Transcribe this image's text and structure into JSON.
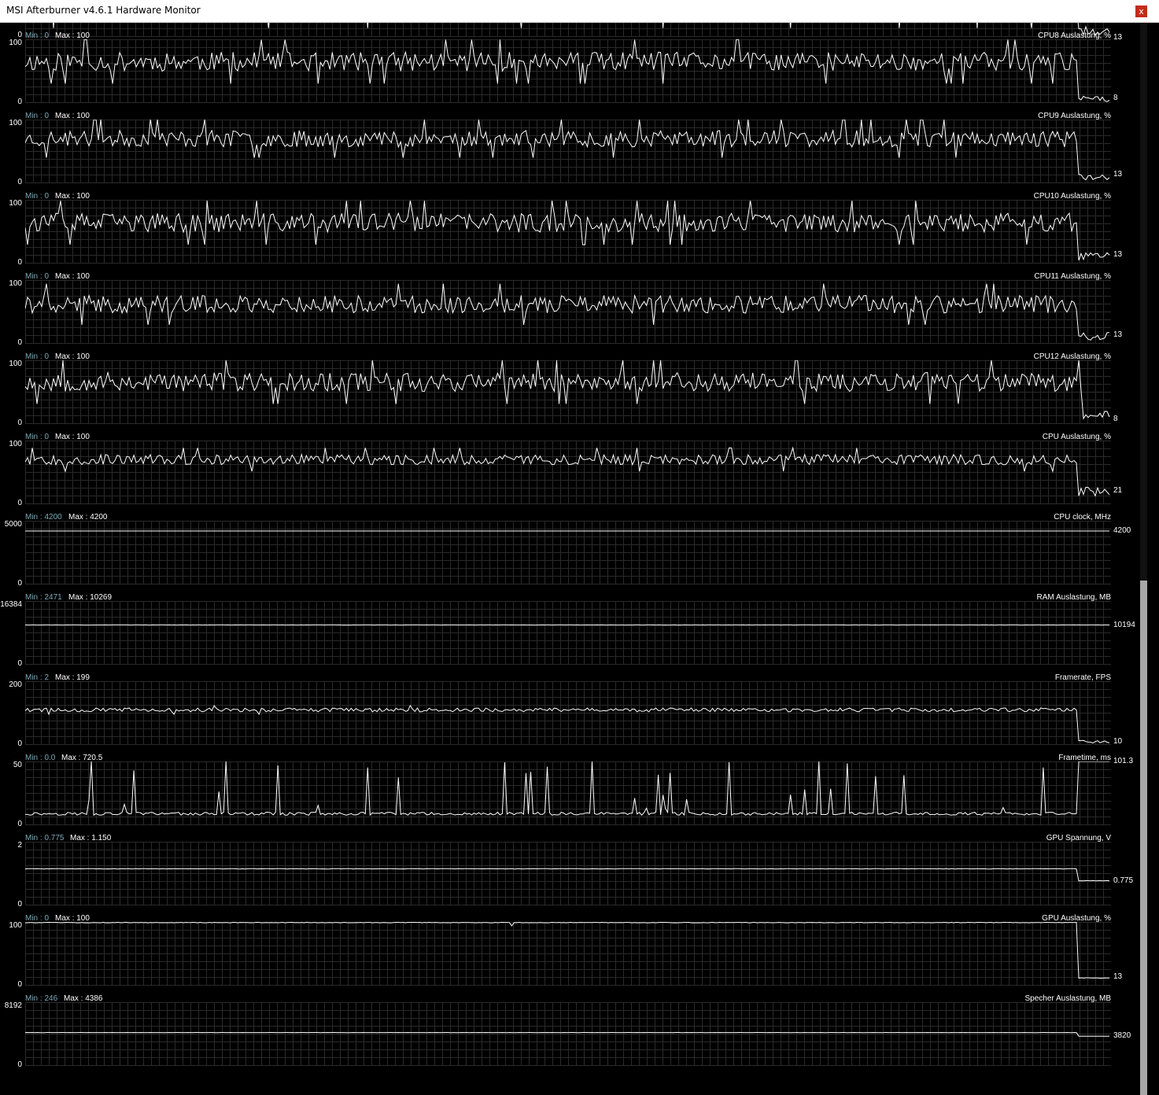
{
  "window": {
    "title": "MSI Afterburner v4.6.1 Hardware Monitor",
    "close_label": "x"
  },
  "scrollbar": {
    "thumb_start": 0.52,
    "thumb_end": 1.0
  },
  "colors": {
    "background": "#000000",
    "grid": "#2a2a2a",
    "trace": "#ffffff",
    "min_label": "#7aa9b9",
    "close_button": "#c42b1c"
  },
  "top_partial": {
    "current": "13"
  },
  "graphs": [
    {
      "name": "CPU8 Auslastung, %",
      "min_label": "Min : 0",
      "max_label": "Max : 100",
      "axis_top": "100",
      "axis_bottom": "0",
      "current": "8",
      "chart_data": {
        "type": "line",
        "ylim": [
          0,
          100
        ],
        "level": 65,
        "noise": 15,
        "spikes": 0.06,
        "end_drop_at": 0.97,
        "end_level": 6,
        "current_value": 8,
        "seed": 11
      }
    },
    {
      "name": "CPU9 Auslastung, %",
      "min_label": "Min : 0",
      "max_label": "Max : 100",
      "axis_top": "100",
      "axis_bottom": "0",
      "current": "13",
      "chart_data": {
        "type": "line",
        "ylim": [
          0,
          100
        ],
        "level": 70,
        "noise": 13,
        "spikes": 0.06,
        "end_drop_at": 0.97,
        "end_level": 10,
        "current_value": 13,
        "seed": 23
      }
    },
    {
      "name": "CPU10 Auslastung, %",
      "min_label": "Min : 0",
      "max_label": "Max : 100",
      "axis_top": "100",
      "axis_bottom": "0",
      "current": "13",
      "chart_data": {
        "type": "line",
        "ylim": [
          0,
          100
        ],
        "level": 64,
        "noise": 15,
        "spikes": 0.06,
        "end_drop_at": 0.97,
        "end_level": 11,
        "current_value": 13,
        "seed": 37
      }
    },
    {
      "name": "CPU11 Auslastung, %",
      "min_label": "Min : 0",
      "max_label": "Max : 100",
      "axis_top": "100",
      "axis_bottom": "0",
      "current": "13",
      "chart_data": {
        "type": "line",
        "ylim": [
          0,
          100
        ],
        "level": 62,
        "noise": 14,
        "spikes": 0.06,
        "end_drop_at": 0.97,
        "end_level": 12,
        "current_value": 13,
        "seed": 41
      }
    },
    {
      "name": "CPU12 Auslastung, %",
      "min_label": "Min : 0",
      "max_label": "Max : 100",
      "axis_top": "100",
      "axis_bottom": "0",
      "current": "8",
      "chart_data": {
        "type": "line",
        "ylim": [
          0,
          100
        ],
        "level": 66,
        "noise": 15,
        "spikes": 0.06,
        "end_drop_at": 0.975,
        "end_level": 14,
        "current_value": 8,
        "seed": 53
      }
    },
    {
      "name": "CPU Auslastung, %",
      "min_label": "Min : 0",
      "max_label": "Max : 100",
      "axis_top": "100",
      "axis_bottom": "0",
      "current": "21",
      "chart_data": {
        "type": "line",
        "ylim": [
          0,
          100
        ],
        "level": 70,
        "noise": 8,
        "spikes": 0.04,
        "end_drop_at": 0.97,
        "end_level": 20,
        "current_value": 21,
        "seed": 67
      }
    },
    {
      "name": "CPU clock, MHz",
      "min_label": "Min : 4200",
      "max_label": "Max : 4200",
      "axis_top": "5000",
      "axis_bottom": "0",
      "current": "4200",
      "chart_data": {
        "type": "line",
        "ylim": [
          0,
          5000
        ],
        "level": 4200,
        "noise": 0,
        "spikes": 0,
        "current_value": 4200,
        "seed": 1
      }
    },
    {
      "name": "RAM Auslastung, MB",
      "min_label": "Min : 2471",
      "max_label": "Max : 10269",
      "axis_top": "16384",
      "axis_bottom": "0",
      "current": "10194",
      "chart_data": {
        "type": "line",
        "ylim": [
          0,
          16384
        ],
        "level": 10220,
        "noise": 25,
        "spikes": 0,
        "current_value": 10194,
        "seed": 2
      }
    },
    {
      "name": "Framerate, FPS",
      "min_label": "Min : 2",
      "max_label": "Max : 199",
      "axis_top": "200",
      "axis_bottom": "0",
      "current": "10",
      "chart_data": {
        "type": "line",
        "ylim": [
          0,
          200
        ],
        "level": 110,
        "noise": 6,
        "spikes": 0.01,
        "end_drop_at": 0.97,
        "end_level": 10,
        "current_value": 10,
        "seed": 79
      }
    },
    {
      "name": "Frametime, ms",
      "min_label": "Min : 0.0",
      "max_label": "Max : 720.5",
      "axis_top": "50",
      "axis_bottom": "0",
      "current": "101.3",
      "chart_data": {
        "type": "line",
        "ylim": [
          0,
          50
        ],
        "level": 9,
        "noise": 1.2,
        "spikes": 0.07,
        "spike_up": true,
        "end_drop_at": 0.97,
        "end_level": 55,
        "current_value": 101.3,
        "seed": 97
      }
    },
    {
      "name": "GPU Spannung, V",
      "min_label": "Min : 0.775",
      "max_label": "Max : 1.150",
      "axis_top": "2",
      "axis_bottom": "0",
      "current": "0.775",
      "chart_data": {
        "type": "line",
        "ylim": [
          0,
          2
        ],
        "level": 1.15,
        "noise": 0.006,
        "spikes": 0,
        "end_drop_at": 0.97,
        "end_level": 0.775,
        "current_value": 0.775,
        "seed": 3
      }
    },
    {
      "name": "GPU Auslastung, %",
      "min_label": "Min : 0",
      "max_label": "Max : 100",
      "axis_top": "100",
      "axis_bottom": "0",
      "current": "13",
      "chart_data": {
        "type": "line",
        "ylim": [
          0,
          100
        ],
        "level": 99,
        "noise": 0.4,
        "spikes": 0.006,
        "spike_down": true,
        "end_drop_at": 0.97,
        "end_level": 12,
        "current_value": 13,
        "seed": 5
      }
    },
    {
      "name": "Specher Auslastung, MB",
      "min_label": "Min : 246",
      "max_label": "Max : 4386",
      "axis_top": "8192",
      "axis_bottom": "0",
      "current": "3820",
      "chart_data": {
        "type": "line",
        "ylim": [
          0,
          8192
        ],
        "level": 4290,
        "noise": 8,
        "spikes": 0,
        "end_drop_at": 0.97,
        "end_level": 3820,
        "current_value": 3820,
        "seed": 7
      }
    }
  ]
}
